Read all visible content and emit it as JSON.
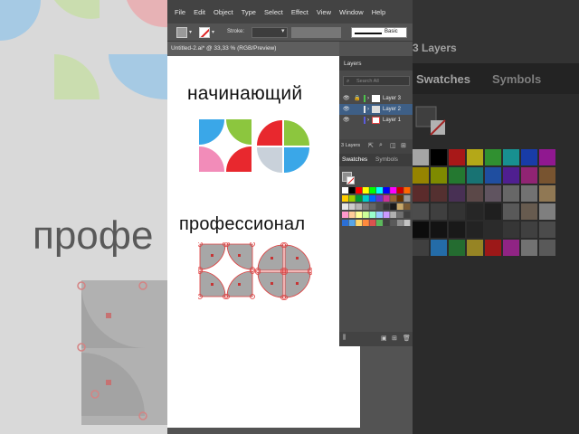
{
  "menu": [
    "File",
    "Edit",
    "Object",
    "Type",
    "Select",
    "Effect",
    "View",
    "Window",
    "Help"
  ],
  "control_bar": {
    "stroke_label": "Stroke:",
    "brush_label": "Basic"
  },
  "document_tab": "Untitled-2.ai* @ 33,33 % (RGB/Preview)",
  "artboard": {
    "heading_beginner": "начинающий",
    "heading_pro": "профессионал"
  },
  "layers_panel": {
    "tab": "Layers",
    "search_placeholder": "Search All",
    "layers": [
      {
        "name": "Layer 3",
        "color": "#4cc34c",
        "selected": false
      },
      {
        "name": "Layer 2",
        "color": "#e8e8e8",
        "selected": true
      },
      {
        "name": "Layer 1",
        "color": "#5b5bdc",
        "selected": false
      }
    ],
    "count_label": "3 Layers"
  },
  "swatches_panel": {
    "tabs": [
      "Swatches",
      "Symbols"
    ]
  },
  "background_right": {
    "layers_count": "3 Layers",
    "tabs": [
      "Swatches",
      "Symbols"
    ]
  },
  "background_left": {
    "text": "профе"
  },
  "colors": {
    "blue": "#3aa7e8",
    "green": "#8cc63e",
    "red": "#e8282e",
    "pink": "#f28cb9",
    "gray": "#c9d1da",
    "selection": "#e03c3c",
    "shape_gray": "#a7a7a7"
  }
}
